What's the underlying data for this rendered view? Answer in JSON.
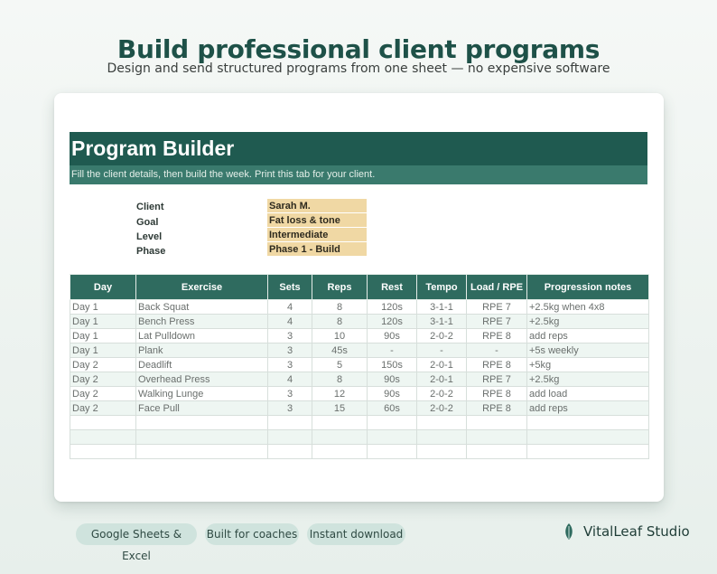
{
  "headline": "Build professional client programs",
  "subheadline": "Design and send structured programs from one sheet — no expensive software",
  "sheet": {
    "title": "Program Builder",
    "subtitle": "Fill the client details, then build the week. Print this tab for your client.",
    "details": [
      {
        "label": "Client",
        "value": "Sarah M."
      },
      {
        "label": "Goal",
        "value": "Fat loss & tone"
      },
      {
        "label": "Level",
        "value": "Intermediate"
      },
      {
        "label": "Phase",
        "value": "Phase 1 - Build"
      }
    ],
    "table": {
      "headers": [
        "Day",
        "Exercise",
        "Sets",
        "Reps",
        "Rest",
        "Tempo",
        "Load / RPE",
        "Progression notes"
      ],
      "rows": [
        [
          "Day 1",
          "Back Squat",
          "4",
          "8",
          "120s",
          "3-1-1",
          "RPE 7",
          "+2.5kg when 4x8"
        ],
        [
          "Day 1",
          "Bench Press",
          "4",
          "8",
          "120s",
          "3-1-1",
          "RPE 7",
          "+2.5kg"
        ],
        [
          "Day 1",
          "Lat Pulldown",
          "3",
          "10",
          "90s",
          "2-0-2",
          "RPE 8",
          "add reps"
        ],
        [
          "Day 1",
          "Plank",
          "3",
          "45s",
          "-",
          "-",
          "-",
          "+5s weekly"
        ],
        [
          "Day 2",
          "Deadlift",
          "3",
          "5",
          "150s",
          "2-0-1",
          "RPE 8",
          "+5kg"
        ],
        [
          "Day 2",
          "Overhead Press",
          "4",
          "8",
          "90s",
          "2-0-1",
          "RPE 7",
          "+2.5kg"
        ],
        [
          "Day 2",
          "Walking Lunge",
          "3",
          "12",
          "90s",
          "2-0-2",
          "RPE 8",
          "add load"
        ],
        [
          "Day 2",
          "Face Pull",
          "3",
          "15",
          "60s",
          "2-0-2",
          "RPE 8",
          "add reps"
        ],
        [
          "",
          "",
          "",
          "",
          "",
          "",
          "",
          ""
        ],
        [
          "",
          "",
          "",
          "",
          "",
          "",
          "",
          ""
        ],
        [
          "",
          "",
          "",
          "",
          "",
          "",
          "",
          ""
        ]
      ]
    }
  },
  "chips": [
    "Google Sheets & Excel",
    "Built for coaches",
    "Instant download"
  ],
  "brand": {
    "name": "VitalLeaf Studio",
    "icon": "leaf-icon"
  },
  "colors": {
    "primary": "#1f5a50",
    "header": "#2f6b5f",
    "highlight": "#f0d8a4",
    "chip": "#cfe3dd"
  }
}
